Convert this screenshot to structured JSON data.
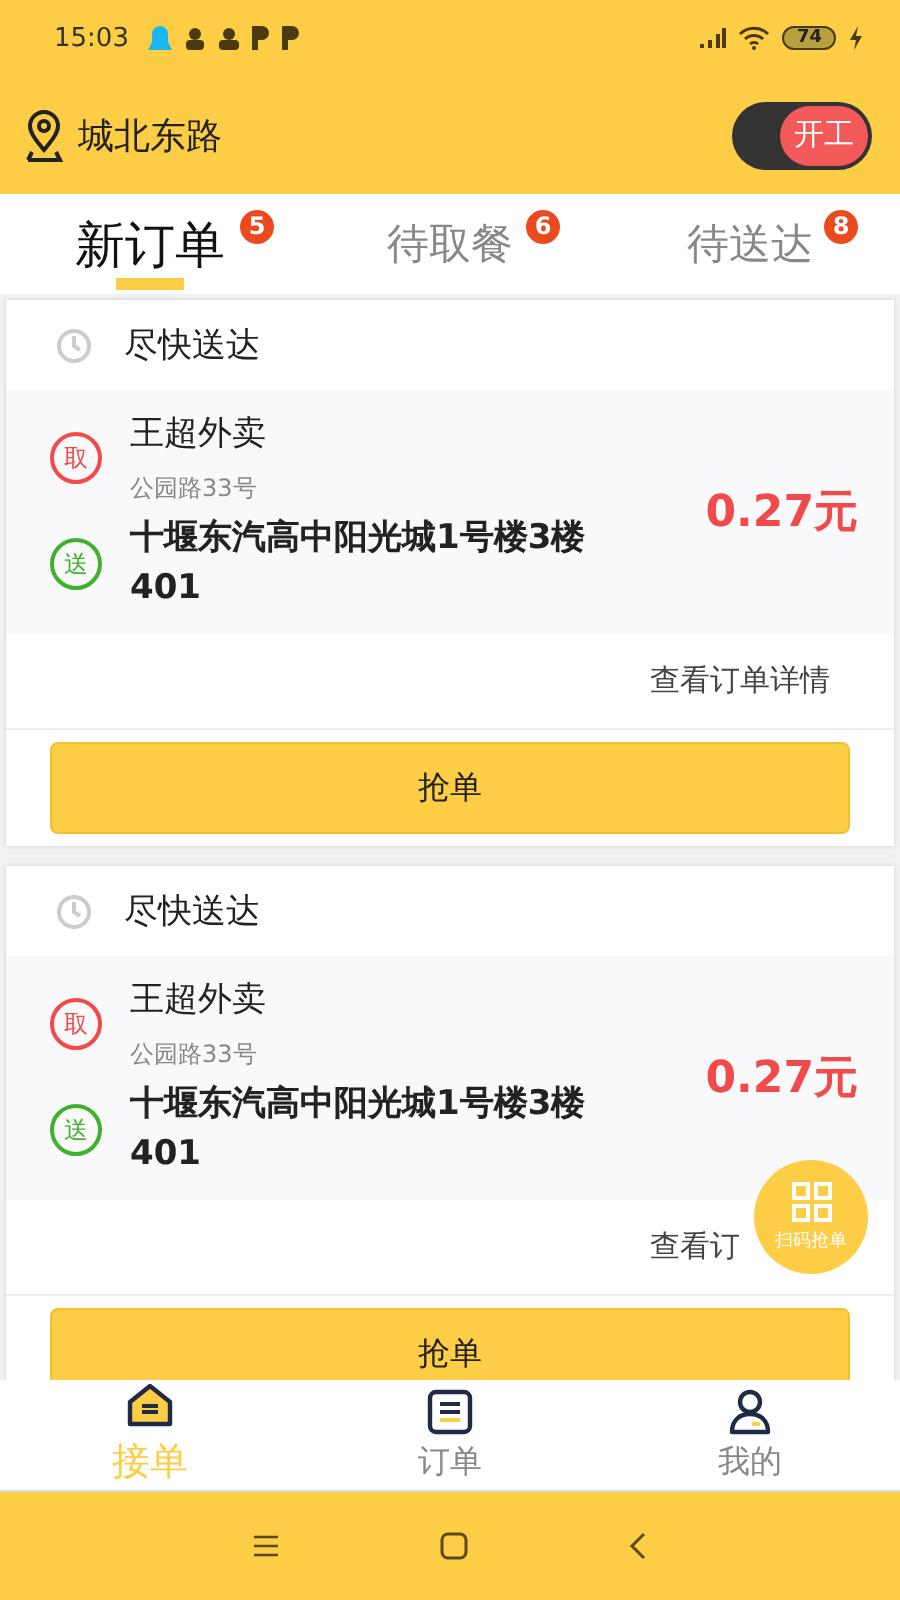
{
  "status_bar": {
    "time": "15:03",
    "battery": "74"
  },
  "header": {
    "location": "城北东路",
    "work_toggle": {
      "label": "开工",
      "on": true
    }
  },
  "tabs": [
    {
      "label": "新订单",
      "badge": "5",
      "selected": true
    },
    {
      "label": "待取餐",
      "badge": "6",
      "selected": false
    },
    {
      "label": "待送达",
      "badge": "8",
      "selected": false
    }
  ],
  "orders": [
    {
      "time": "尽快送达",
      "pickup_mark": "取",
      "shop": "王超外卖",
      "shop_address": "公园路33号",
      "deliver_mark": "送",
      "destination": "十堰东汽高中阳光城1号楼3楼401",
      "price": "0.27元",
      "details_link": "查看订单详情",
      "action": "抢单"
    },
    {
      "time": "尽快送达",
      "pickup_mark": "取",
      "shop": "王超外卖",
      "shop_address": "公园路33号",
      "deliver_mark": "送",
      "destination": "十堰东汽高中阳光城1号楼3楼401",
      "price": "0.27元",
      "details_link": "查看订",
      "action": "抢单"
    }
  ],
  "scan_button": {
    "label": "扫码抢单"
  },
  "bottom_nav": [
    {
      "label": "接单",
      "kind": "home",
      "selected": true
    },
    {
      "label": "订单",
      "kind": "list",
      "selected": false
    },
    {
      "label": "我的",
      "kind": "user",
      "selected": false
    }
  ]
}
